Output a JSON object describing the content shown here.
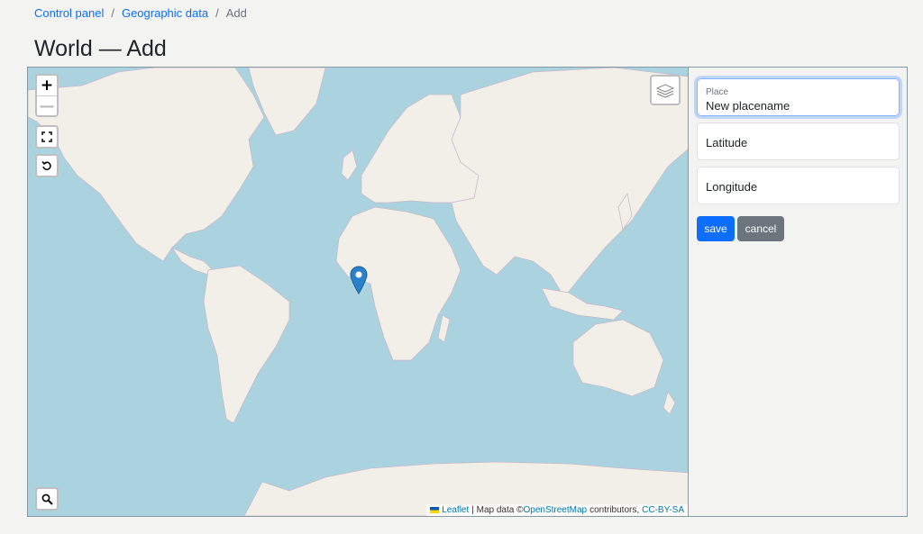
{
  "breadcrumb": {
    "items": [
      "Control panel",
      "Geographic data"
    ],
    "current": "Add",
    "separator": "/"
  },
  "page": {
    "title": "World — Add"
  },
  "map": {
    "controls": {
      "zoom_in": "+",
      "zoom_out": "—",
      "zoom_in_icon": "plus-icon",
      "zoom_out_icon": "minus-icon",
      "fullscreen_icon": "fullscreen-icon",
      "reset_icon": "reset-view-icon",
      "search_icon": "search-icon",
      "layers_icon": "layers-icon"
    },
    "marker_icon": "map-marker-icon",
    "attribution": {
      "leaflet": "Leaflet",
      "map_data": "| Map data ©",
      "osm": "OpenStreetMap",
      "contributors": "contributors,",
      "license": "CC-BY-SA"
    },
    "colors": {
      "water": "#aad3df",
      "land": "#f2efe9",
      "marker": "#2a81cb"
    }
  },
  "form": {
    "place_label": "Place",
    "place_value": "New placename",
    "latitude_placeholder": "Latitude",
    "longitude_placeholder": "Longitude",
    "save_label": "save",
    "cancel_label": "cancel"
  },
  "colors": {
    "primary": "#0d6efd",
    "secondary": "#6c757d"
  }
}
